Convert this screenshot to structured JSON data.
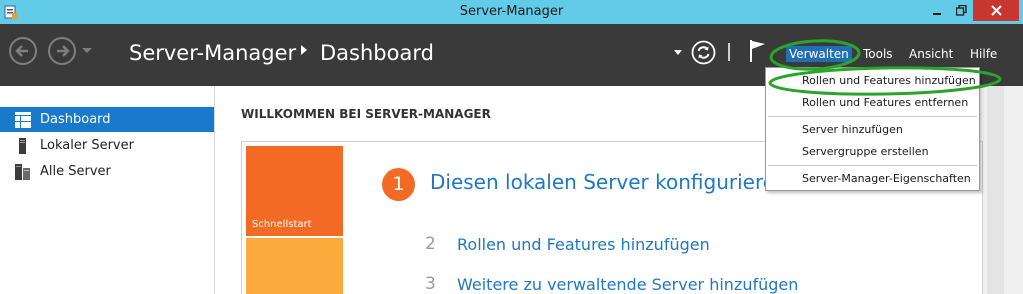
{
  "window": {
    "title": "Server-Manager"
  },
  "header": {
    "breadcrumb_root": "Server-Manager",
    "breadcrumb_page": "Dashboard",
    "menus": {
      "verwalten": "Verwalten",
      "tools": "Tools",
      "ansicht": "Ansicht",
      "hilfe": "Hilfe"
    }
  },
  "sidebar": {
    "items": [
      {
        "label": "Dashboard",
        "icon": "dashboard-grid-icon",
        "active": true
      },
      {
        "label": "Lokaler Server",
        "icon": "server-icon",
        "active": false
      },
      {
        "label": "Alle Server",
        "icon": "servers-icon",
        "active": false
      }
    ]
  },
  "main": {
    "welcome_title": "WILLKOMMEN BEI SERVER-MANAGER",
    "tile_label": "Schnellstart",
    "steps": [
      {
        "number": "1",
        "text": "Diesen lokalen Server konfigurieren"
      },
      {
        "number": "2",
        "text": "Rollen und Features hinzufügen"
      },
      {
        "number": "3",
        "text": "Weitere zu verwaltende Server hinzufügen"
      }
    ]
  },
  "dropdown": {
    "items": [
      "Rollen und Features hinzufügen",
      "Rollen und Features entfernen",
      "Server hinzufügen",
      "Servergruppe erstellen",
      "Server-Manager-Eigenschaften"
    ]
  },
  "colors": {
    "titlebar": "#62cbe8",
    "header": "#3a3a3a",
    "accent": "#1979ca",
    "orange": "#f26a24",
    "annotation": "#2aa52a"
  }
}
